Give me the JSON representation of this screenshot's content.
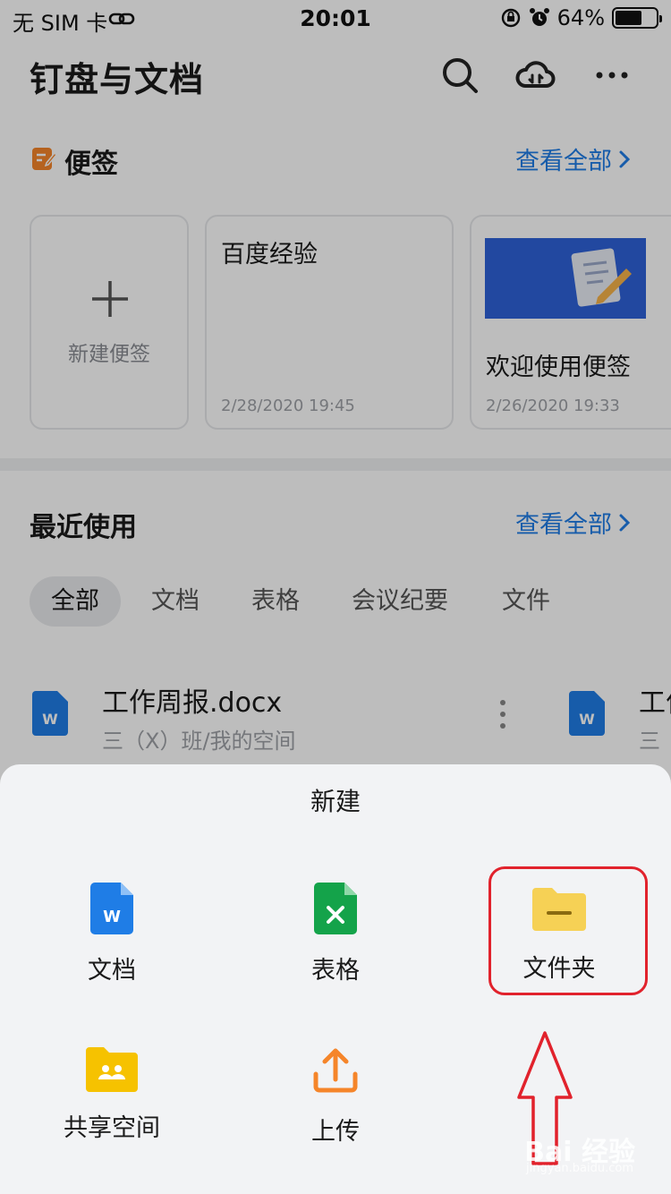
{
  "status_bar": {
    "carrier": "无 SIM 卡",
    "time": "20:01",
    "battery": "64%"
  },
  "header": {
    "title": "钉盘与文档"
  },
  "notes": {
    "title": "便签",
    "see_all": "查看全部",
    "new_label": "新建便签",
    "cards": [
      {
        "title": "百度经验",
        "date": "2/28/2020 19:45"
      },
      {
        "title": "欢迎使用便签",
        "date": "2/26/2020 19:33"
      }
    ]
  },
  "recent": {
    "title": "最近使用",
    "see_all": "查看全部",
    "filters": [
      "全部",
      "文档",
      "表格",
      "会议纪要",
      "文件"
    ],
    "files": [
      {
        "name": "工作周报.docx",
        "path": "三（X）班/我的空间"
      },
      {
        "name": "工作",
        "path": "三"
      }
    ]
  },
  "create_sheet": {
    "title": "新建",
    "options": [
      {
        "label": "文档",
        "icon": "word-doc-icon",
        "color": "#1f7de6"
      },
      {
        "label": "表格",
        "icon": "spreadsheet-icon",
        "color": "#14a34a"
      },
      {
        "label": "文件夹",
        "icon": "folder-icon",
        "color": "#f6d155"
      },
      {
        "label": "共享空间",
        "icon": "shared-space-icon",
        "color": "#f6c200"
      },
      {
        "label": "上传",
        "icon": "upload-icon",
        "color": "#f5852a"
      }
    ]
  },
  "watermark": {
    "brand": "Bai 经验",
    "sub": "jingyan.baidu.com"
  },
  "colors": {
    "accent": "#1f7de6",
    "highlight": "#e1222c"
  }
}
